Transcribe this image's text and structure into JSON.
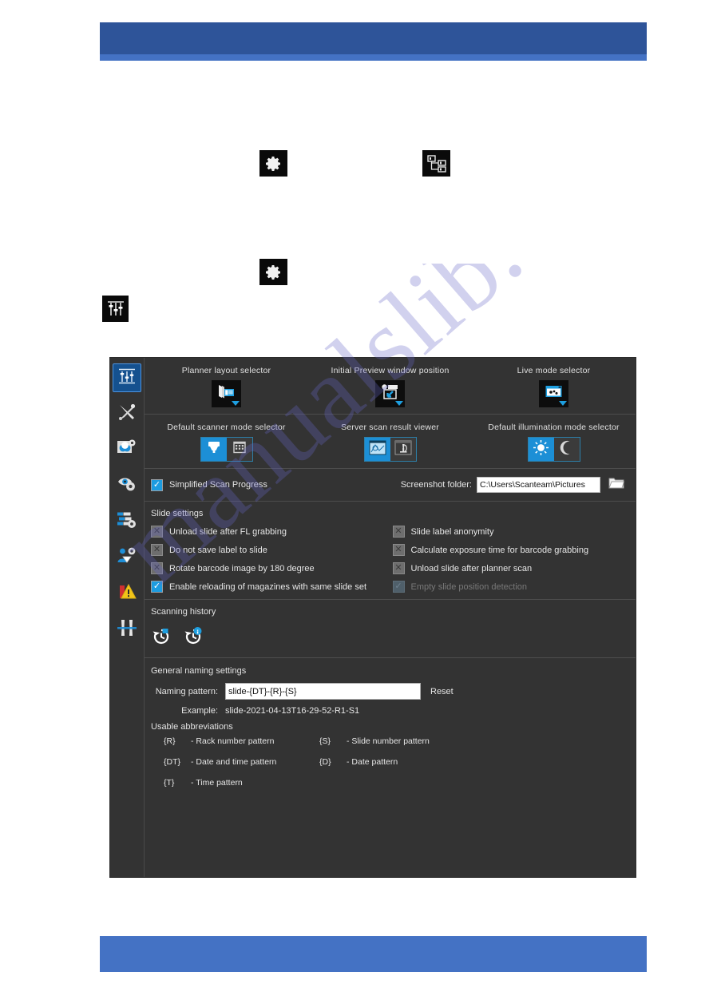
{
  "watermark": {
    "text": "manualslib.com"
  },
  "page_icons": [
    {
      "name": "gear-icon",
      "glyph": "gear"
    },
    {
      "name": "tree-hierarchy-icon",
      "glyph": "tree"
    },
    {
      "name": "gear-icon",
      "glyph": "gear"
    },
    {
      "name": "sliders-icon",
      "glyph": "sliders"
    }
  ],
  "app": {
    "sidebar": {
      "items": [
        {
          "name": "sidebar-item-general-settings",
          "icon": "sliders-icon",
          "active": true
        },
        {
          "name": "sidebar-item-maintenance",
          "icon": "tools-icon",
          "active": false
        },
        {
          "name": "sidebar-item-image-settings",
          "icon": "image-gear-icon",
          "active": false
        },
        {
          "name": "sidebar-item-preview-settings",
          "icon": "eye-gear-icon",
          "active": false
        },
        {
          "name": "sidebar-item-workflow-settings",
          "icon": "list-gear-icon",
          "active": false
        },
        {
          "name": "sidebar-item-user-settings",
          "icon": "user-gear-icon",
          "active": false
        },
        {
          "name": "sidebar-item-warnings",
          "icon": "warning-icon",
          "active": false
        },
        {
          "name": "sidebar-item-calibration",
          "icon": "calibration-icon",
          "active": false
        }
      ]
    },
    "selectors_row1": [
      {
        "label": "Planner layout selector",
        "icon": "planner-layout-icon",
        "has_dropdown": true
      },
      {
        "label": "Initial Preview window position",
        "icon": "preview-position-icon",
        "has_dropdown": true
      },
      {
        "label": "Live mode selector",
        "icon": "live-mode-icon",
        "has_dropdown": true
      }
    ],
    "selectors_row2": [
      {
        "label": "Default scanner mode selector",
        "options": [
          {
            "icon": "scanner-icon",
            "selected": true
          },
          {
            "icon": "grid-icon",
            "selected": false
          }
        ]
      },
      {
        "label": "Server scan result viewer",
        "options": [
          {
            "icon": "slide-map-icon",
            "selected": true
          },
          {
            "icon": "microscope-icon",
            "selected": false
          }
        ]
      },
      {
        "label": "Default illumination mode selector",
        "options": [
          {
            "icon": "sun-icon",
            "selected": true
          },
          {
            "icon": "moon-icon",
            "selected": false
          }
        ]
      }
    ],
    "progress_strip": {
      "simplified_scan_progress": {
        "label": "Simplified Scan Progress",
        "checked": true
      },
      "screenshot_folder": {
        "label": "Screenshot folder:",
        "value": "C:\\Users\\Scanteam\\Pictures",
        "browse_icon": "folder-icon"
      }
    },
    "slide_settings": {
      "title": "Slide settings",
      "items": [
        {
          "label": "Unload slide after FL grabbing",
          "state": "off"
        },
        {
          "label": "Slide label anonymity",
          "state": "off"
        },
        {
          "label": "Do not save label to slide",
          "state": "off"
        },
        {
          "label": "Calculate exposure time for barcode grabbing",
          "state": "off"
        },
        {
          "label": "Rotate barcode image by 180 degree",
          "state": "off"
        },
        {
          "label": "Unload slide after planner scan",
          "state": "off"
        },
        {
          "label": "Enable reloading of magazines with same slide set",
          "state": "on"
        },
        {
          "label": "Empty slide position detection",
          "state": "disabled"
        }
      ]
    },
    "scanning_history": {
      "title": "Scanning history",
      "buttons": [
        {
          "name": "history-restore-button",
          "icon": "history-restore-icon"
        },
        {
          "name": "history-info-button",
          "icon": "history-info-icon"
        }
      ]
    },
    "naming_settings": {
      "title": "General naming settings",
      "pattern_label": "Naming pattern:",
      "pattern_value": "slide-{DT}-{R}-{S}",
      "reset_label": "Reset",
      "example_label": "Example:",
      "example_value": "slide-2021-04-13T16-29-52-R1-S1",
      "abbrev_title": "Usable abbreviations",
      "abbreviations": [
        {
          "key": "{R}",
          "desc": "- Rack number pattern"
        },
        {
          "key": "{S}",
          "desc": "- Slide number pattern"
        },
        {
          "key": "{DT}",
          "desc": "- Date and time pattern"
        },
        {
          "key": "{D}",
          "desc": "- Date pattern"
        },
        {
          "key": "{T}",
          "desc": "- Time pattern"
        }
      ]
    }
  },
  "colors": {
    "header_blue": "#2e5499",
    "accent_blue": "#4472c4",
    "panel_bg": "#333333",
    "active_blue": "#15518f",
    "toggle_blue": "#1c8fd6",
    "check_blue": "#1c9ce0"
  }
}
